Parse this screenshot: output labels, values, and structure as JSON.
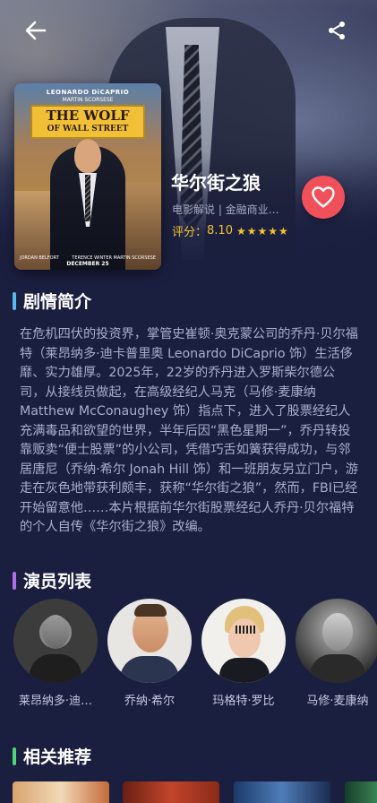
{
  "movie": {
    "title": "华尔街之狼",
    "tags": "电影解说 | 金融商业…",
    "rating_label": "评分：",
    "rating_value": "8.10",
    "stars": "★★★★★",
    "stars_value": 4.5
  },
  "poster": {
    "star_name": "LEONARDO DiCAPRIO",
    "director_name": "MARTIN SCORSESE",
    "title_line1": "THE WOLF",
    "title_line2": "OF WALL STREET",
    "credit_left": "JORDAN BELFORT",
    "credit_right": "TERENCE WINTER  MARTIN SCORSESE",
    "release": "DECEMBER 25"
  },
  "sections": {
    "synopsis_title": "剧情简介",
    "cast_title": "演员列表",
    "related_title": "相关推荐"
  },
  "synopsis": "在危机四伏的投资界，掌管史崔顿·奥克蒙公司的乔丹·贝尔福特（莱昂纳多·迪卡普里奥 Leonardo DiCaprio 饰）生活侈靡、实力雄厚。2025年，22岁的乔丹进入罗斯柴尔德公司，从接线员做起，在高级经纪人马克（马修·麦康纳 Matthew McConaughey 饰）指点下，进入了股票经纪人充满毒品和欲望的世界，半年后因“黑色星期一”，乔丹转投靠贩卖“便士股票”的小公司，凭借巧舌如簧获得成功，与邻居唐尼（乔纳·希尔 Jonah Hill 饰）和一班朋友另立门户，游走在灰色地带获利颇丰，获称“华尔街之狼”，然而，FBI已经开始留意他……本片根据前华尔街股票经纪人乔丹·贝尔福特的个人自传《华尔街之狼》改编。",
  "cast": [
    {
      "name": "莱昂纳多·迪…"
    },
    {
      "name": "乔纳·希尔"
    },
    {
      "name": "玛格特·罗比"
    },
    {
      "name": "马修·麦康纳"
    }
  ],
  "colors": {
    "background": "#1b1f3f",
    "accent_blue": "#5ab8f0",
    "accent_purple": "#b06ee8",
    "accent_green": "#4fd67a",
    "favorite": "#f0505a",
    "rating": "#f2c232"
  }
}
